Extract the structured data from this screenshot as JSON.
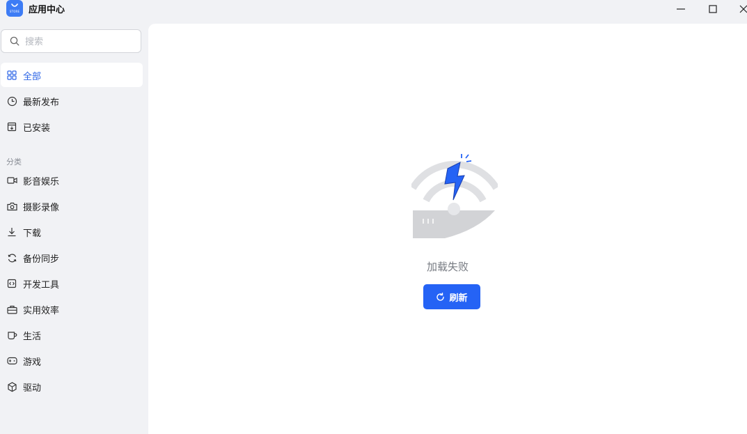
{
  "window": {
    "title": "应用中心",
    "logo_text": "STORE"
  },
  "sidebar": {
    "search_placeholder": "搜索",
    "items": [
      {
        "label": "全部",
        "icon": "grid-icon",
        "active": true
      },
      {
        "label": "最新发布",
        "icon": "clock-icon"
      },
      {
        "label": "已安装",
        "icon": "installed-box-icon"
      }
    ],
    "category_label": "分类",
    "categories": [
      {
        "label": "影音娱乐",
        "icon": "video-camera-icon"
      },
      {
        "label": "摄影录像",
        "icon": "camera-icon"
      },
      {
        "label": "下载",
        "icon": "download-icon"
      },
      {
        "label": "备份同步",
        "icon": "sync-icon"
      },
      {
        "label": "开发工具",
        "icon": "code-icon"
      },
      {
        "label": "实用效率",
        "icon": "toolbox-icon"
      },
      {
        "label": "生活",
        "icon": "cup-icon"
      },
      {
        "label": "游戏",
        "icon": "gamepad-icon"
      },
      {
        "label": "驱动",
        "icon": "cube-icon"
      }
    ]
  },
  "main": {
    "status_text": "加载失败",
    "refresh_label": "刷新"
  },
  "colors": {
    "accent": "#2563f5",
    "active_text": "#2a63e6",
    "sidebar_bg": "#f1f2f5",
    "content_bg": "#ffffff",
    "lightning": "#2563f5",
    "illustration_gray": "#d9dadd"
  }
}
